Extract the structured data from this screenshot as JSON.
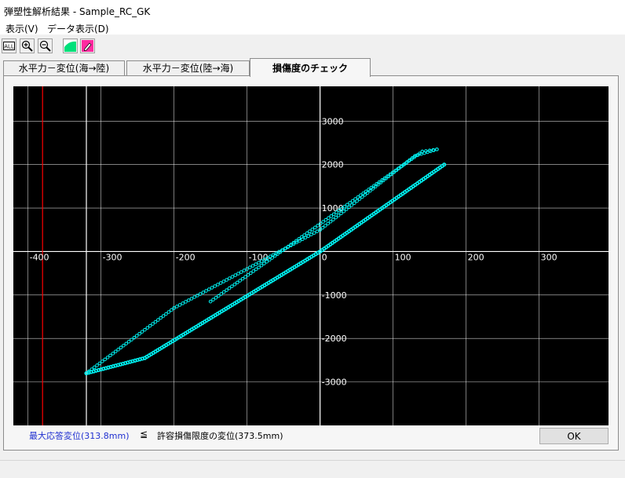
{
  "window": {
    "title": "弾塑性解析結果 - Sample_RC_GK"
  },
  "menu": [
    {
      "label": "表示(V)"
    },
    {
      "label": "データ表示(D)"
    }
  ],
  "toolbar": {
    "buttons": [
      {
        "name": "all-icon",
        "glyph": "ALL"
      },
      {
        "name": "zoom-in-icon"
      },
      {
        "name": "zoom-out-icon"
      },
      {
        "name": "graph-color-icon",
        "color": "#00e07a"
      },
      {
        "name": "pen-color-icon",
        "color": "#ff2aa0"
      }
    ]
  },
  "tabs": [
    {
      "label": "水平力－変位(海→陸)",
      "active": false
    },
    {
      "label": "水平力－変位(陸→海)",
      "active": false
    },
    {
      "label": "損傷度のチェック",
      "active": true
    }
  ],
  "chart_data": {
    "type": "scatter",
    "xlim": [
      -420,
      395
    ],
    "ylim": [
      -4000,
      3800
    ],
    "x_ticks": [
      -400,
      -300,
      -200,
      -100,
      0,
      100,
      200,
      300
    ],
    "y_ticks": [
      -3000,
      -2000,
      -1000,
      0,
      1000,
      2000,
      3000
    ],
    "grid": true,
    "colors": {
      "background": "#000000",
      "grid": "#ffffff",
      "series": "#00f0f0",
      "limit": "#ff0000"
    },
    "reference_lines": [
      {
        "kind": "limit",
        "x": -380,
        "color": "#ff0000"
      },
      {
        "kind": "max-response",
        "x": -320,
        "color": "#ffffff"
      }
    ],
    "series": [
      {
        "points": [
          [
            -320,
            -2800
          ],
          [
            -240,
            -2450
          ],
          [
            0,
            0
          ],
          [
            170,
            2000
          ]
        ]
      },
      {
        "points": [
          [
            -320,
            -2800
          ],
          [
            -200,
            -1300
          ],
          [
            0,
            500
          ],
          [
            130,
            2200
          ],
          [
            160,
            2350
          ],
          [
            140,
            2300
          ],
          [
            -150,
            -1150
          ]
        ]
      }
    ]
  },
  "result": {
    "max_response": "最大応答変位(313.8mm)",
    "comparison": "≦",
    "allowable": "許容損傷限度の変位(373.5mm)"
  },
  "ok_button": {
    "label": "OK"
  }
}
